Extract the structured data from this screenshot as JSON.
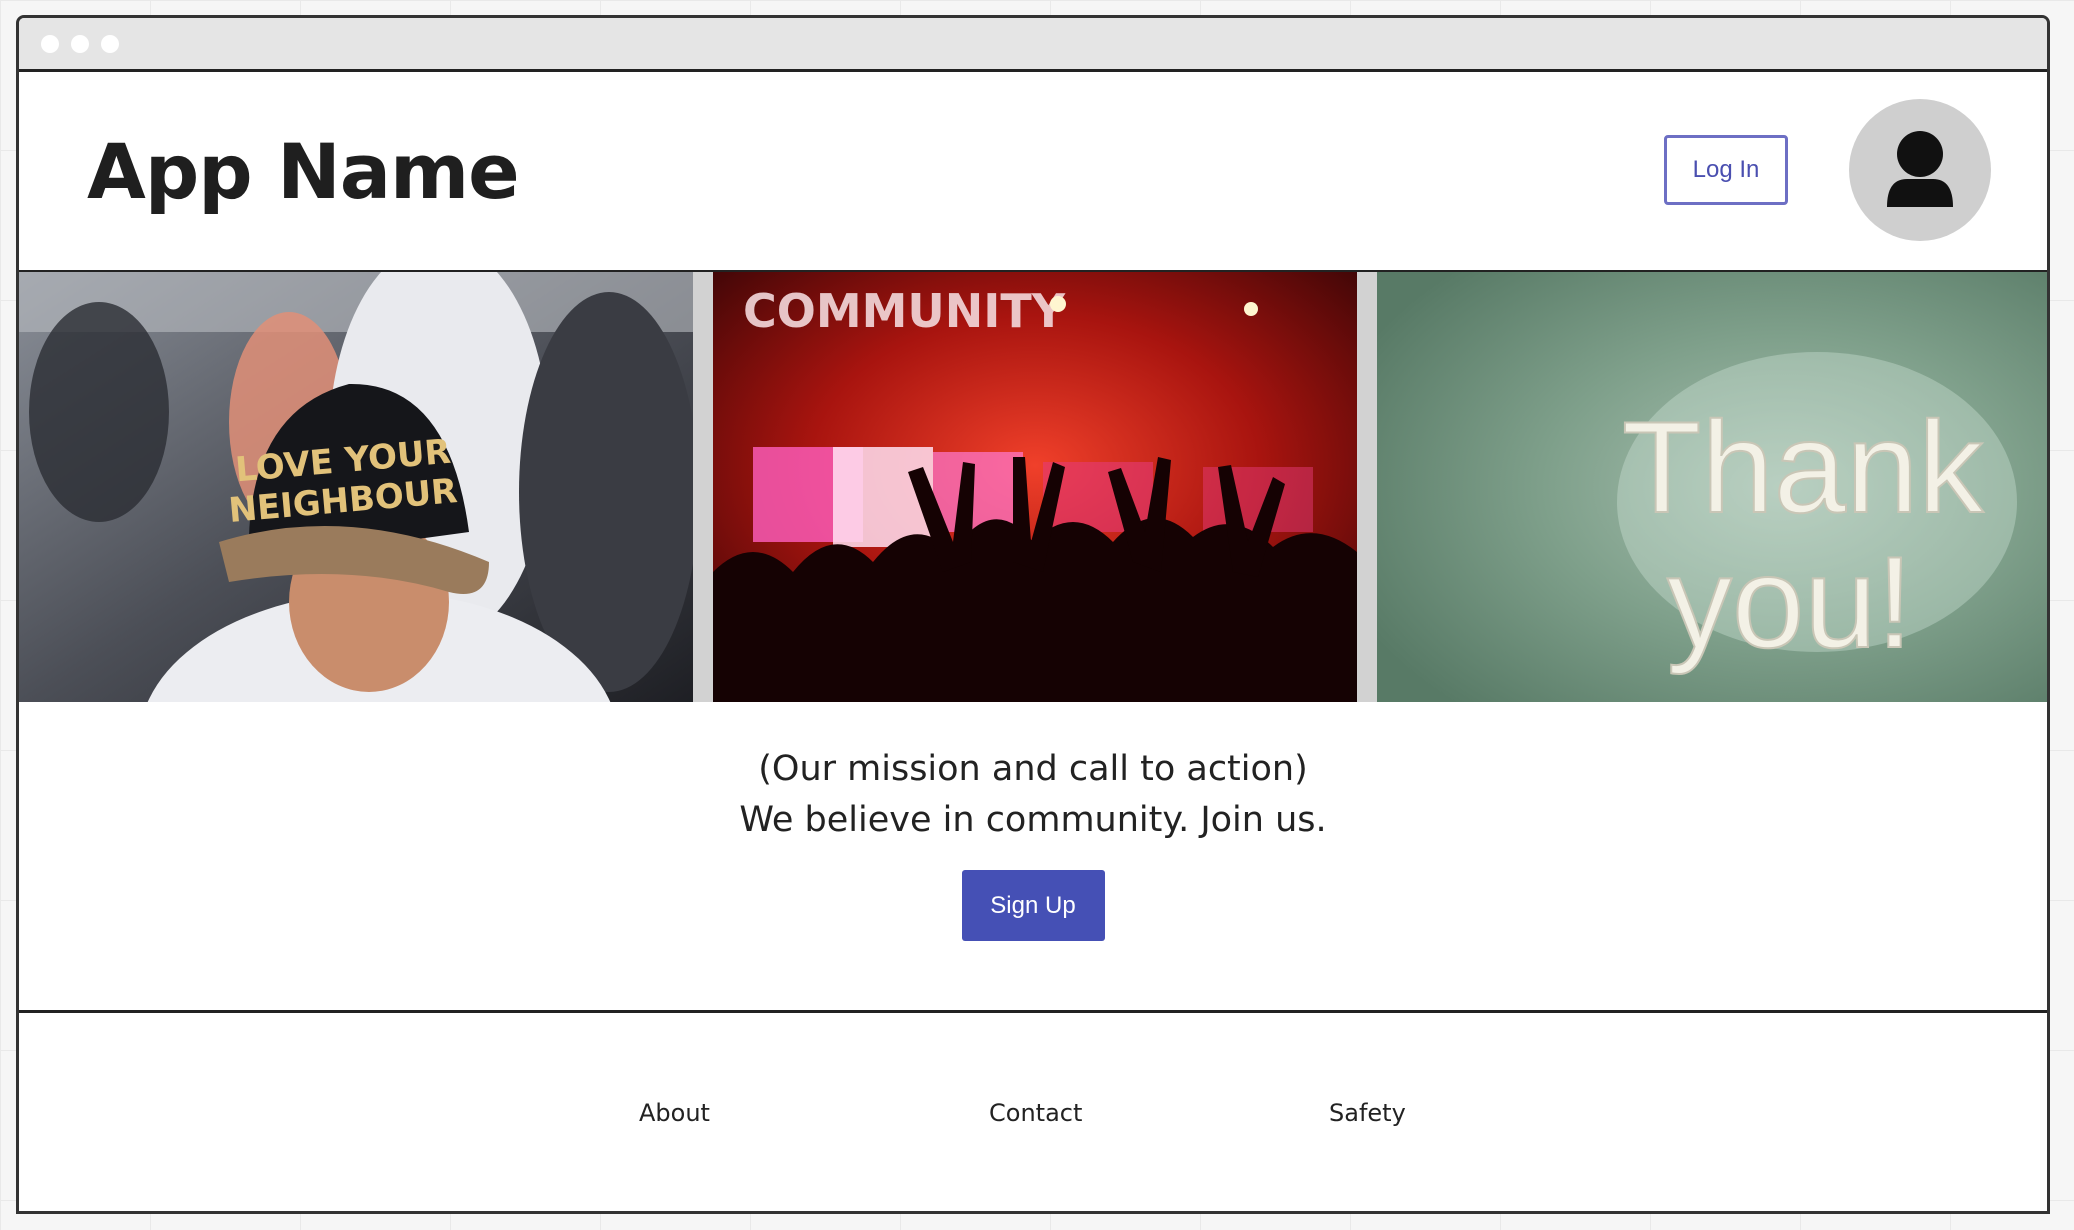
{
  "header": {
    "app_name": "App Name",
    "login_label": "Log In",
    "avatar_icon": "user-icon"
  },
  "hero": {
    "images": [
      {
        "name": "love-your-neighbour-photo",
        "cap_line1": "LOVE YOUR",
        "cap_line2": "NEIGHBOUR"
      },
      {
        "name": "community-concert-photo",
        "sign": "COMMUNITY"
      },
      {
        "name": "thank-you-sign-photo",
        "line1": "Thank",
        "line2": "you!"
      }
    ]
  },
  "mission": {
    "line1": "(Our mission and call to action)",
    "line2": "We believe in community.  Join us.",
    "signup_label": "Sign Up"
  },
  "footer": {
    "links": [
      "About",
      "Contact",
      "Safety"
    ]
  },
  "colors": {
    "accent": "#4550b5",
    "login_border": "#6d6fc4",
    "avatar_bg": "#cfcfcf"
  }
}
